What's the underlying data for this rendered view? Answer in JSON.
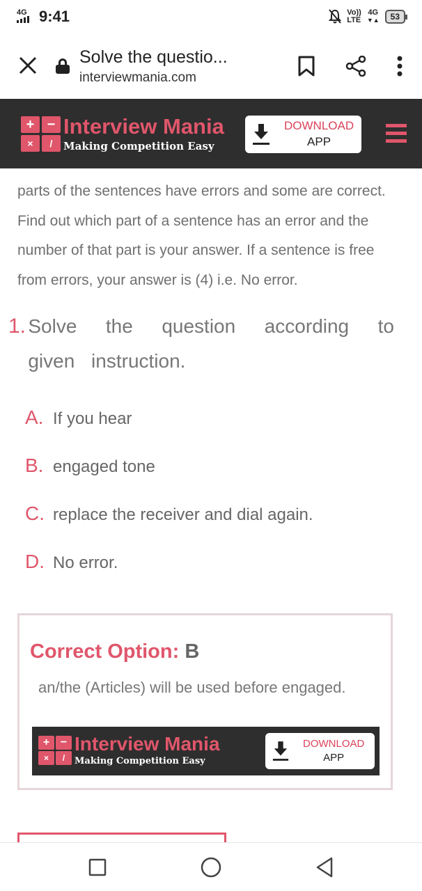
{
  "status_bar": {
    "network": "4G",
    "time": "9:41",
    "volte": "Vo))",
    "lte": "LTE",
    "network_right": "4G",
    "battery": "53"
  },
  "browser": {
    "page_title": "Solve the questio...",
    "host": "interviewmania.com"
  },
  "site_header": {
    "logo_name": "Interview Mania",
    "logo_tagline": "Making Competition Easy",
    "download_line1": "DOWNLOAD",
    "download_line2": "APP"
  },
  "instruction_text": "parts of the sentences have errors and some are correct. Find out which part of a sentence has an error and the number of that part is your answer. If a sentence is free from errors, your answer is (4) i.e. No error.",
  "question": {
    "number": "1.",
    "text": "Solve the question according to given instruction."
  },
  "options": [
    {
      "letter": "A.",
      "text": "If you hear"
    },
    {
      "letter": "B.",
      "text": "engaged tone"
    },
    {
      "letter": "C.",
      "text": "replace the receiver and dial again."
    },
    {
      "letter": "D.",
      "text": "No error."
    }
  ],
  "answer": {
    "label": "Correct Option:",
    "option": "B",
    "explanation": "an/the (Articles) will be used before engaged."
  },
  "banner": {
    "logo_name": "Interview Mania",
    "logo_tagline": "Making Competition Easy",
    "download_line1": "DOWNLOAD",
    "download_line2": "APP"
  },
  "colors": {
    "brand_pink": "#e0566b",
    "header_dark": "#2f2e2e",
    "body_text": "#6f6f6f"
  },
  "icons": [
    "close-icon",
    "lock-icon",
    "bookmark-icon",
    "share-icon",
    "more-vert-icon",
    "download-icon",
    "hamburger-menu-icon",
    "nav-recents-icon",
    "nav-home-icon",
    "nav-back-icon"
  ]
}
